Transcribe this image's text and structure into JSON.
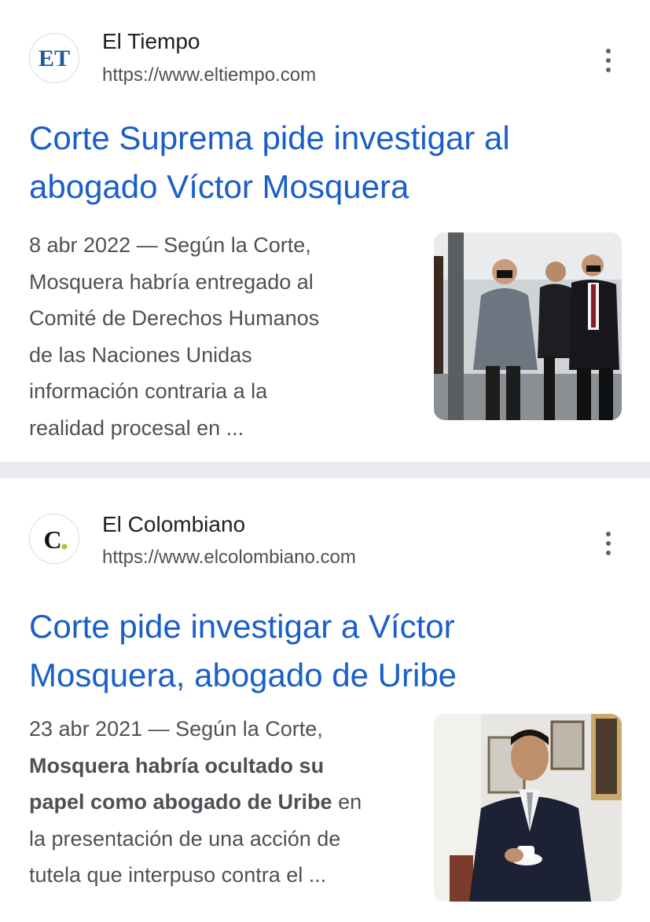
{
  "results": [
    {
      "site_name": "El Tiempo",
      "site_url": "https://www.eltiempo.com",
      "favicon_text": "ET",
      "favicon_color": "#1f5a96",
      "title_line1": "Corte Suprema pide investigar al",
      "title_line2": "abogado Víctor Mosquera",
      "snippet_date": "8 abr 2022",
      "snippet_sep": " — ",
      "snippet_lines": [
        "Según la Corte,",
        "Mosquera habría entregado al",
        "Comité de Derechos Humanos",
        "de las Naciones Unidas",
        "información contraria a la",
        "realidad procesal en ..."
      ],
      "thumbnail_icon": "photo-men-walking-suits"
    },
    {
      "site_name": "El Colombiano",
      "site_url": "https://www.elcolombiano.com",
      "favicon_text": "C",
      "favicon_color": "#111111",
      "favicon_dot_color": "#9acd32",
      "title_line1": "Corte pide investigar a Víctor",
      "title_line2": "Mosquera, abogado de Uribe",
      "snippet_date": "23 abr 2021",
      "snippet_sep": " — ",
      "snippet_line1": "Según la Corte,",
      "snippet_bold1": "Mosquera habría ocultado su",
      "snippet_bold2": "papel como abogado de Uribe",
      "snippet_after_bold": " en",
      "snippet_line4": "la presentación de una acción de",
      "snippet_line5": "tutela que interpuso contra el ...",
      "thumbnail_icon": "photo-man-holding-cup"
    }
  ],
  "colors": {
    "link": "#1a5fc8",
    "snippet": "#4d5156",
    "divider": "#e8eaed"
  }
}
